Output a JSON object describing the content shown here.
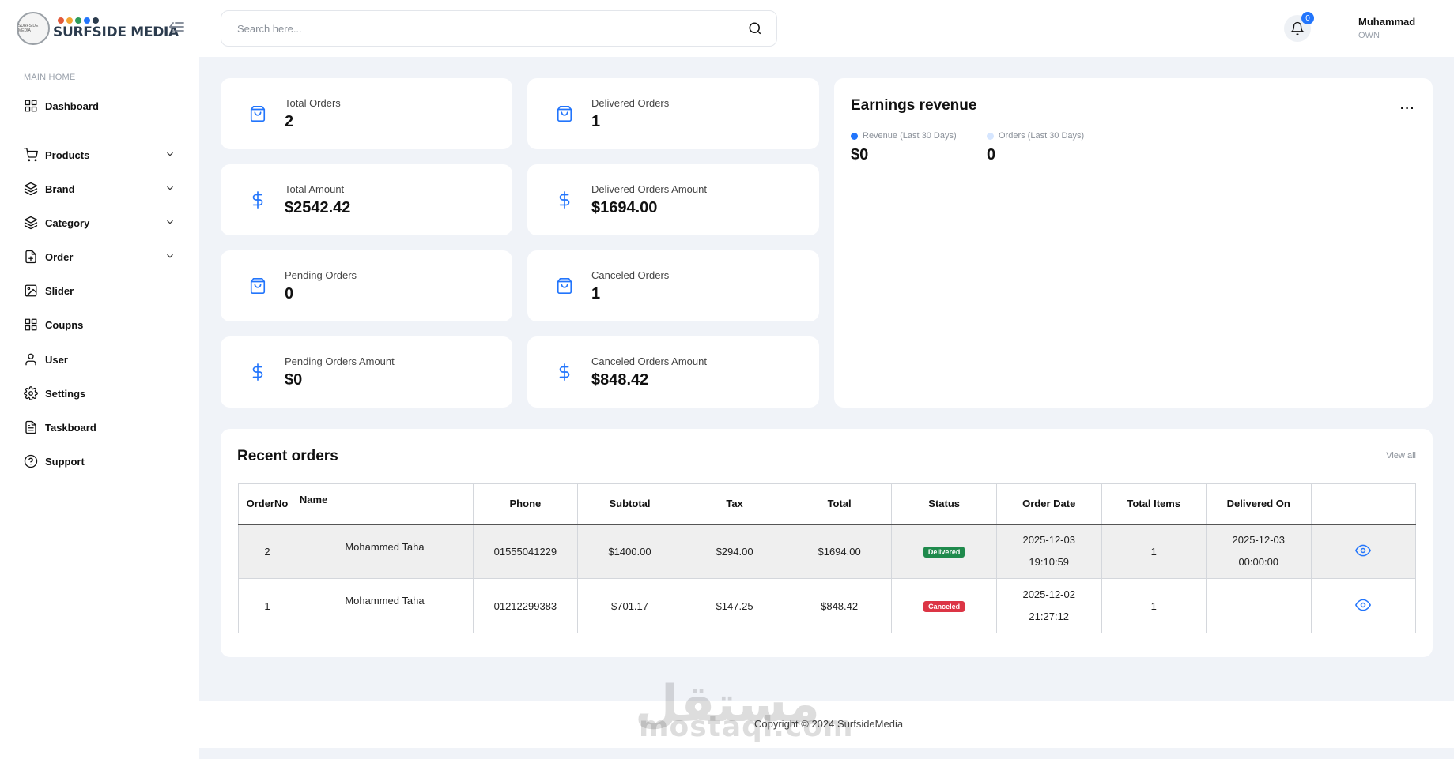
{
  "brand": {
    "name": "SURFSIDE MEDIA",
    "badge_text": "SURFSIDE MEDIA",
    "dot_colors": [
      "#e35b3b",
      "#f3a531",
      "#2e9c5a",
      "#2275fc",
      "#2b3b4d"
    ]
  },
  "sidebar": {
    "section_label": "MAIN HOME",
    "items": [
      {
        "label": "Dashboard",
        "icon": "grid-icon",
        "has_chevron": false
      },
      {
        "label": "Products",
        "icon": "cart-icon",
        "has_chevron": true
      },
      {
        "label": "Brand",
        "icon": "layers-icon",
        "has_chevron": true
      },
      {
        "label": "Category",
        "icon": "layers-icon",
        "has_chevron": true
      },
      {
        "label": "Order",
        "icon": "file-plus-icon",
        "has_chevron": true
      },
      {
        "label": "Slider",
        "icon": "image-icon",
        "has_chevron": false
      },
      {
        "label": "Coupns",
        "icon": "grid-icon",
        "has_chevron": false
      },
      {
        "label": "User",
        "icon": "user-icon",
        "has_chevron": false
      },
      {
        "label": "Settings",
        "icon": "gear-icon",
        "has_chevron": false
      },
      {
        "label": "Taskboard",
        "icon": "file-text-icon",
        "has_chevron": false
      },
      {
        "label": "Support",
        "icon": "help-circle-icon",
        "has_chevron": false
      }
    ]
  },
  "header": {
    "search_placeholder": "Search here...",
    "notification_count": "0",
    "user_name": "Muhammad",
    "user_role": "OWN"
  },
  "stats": [
    {
      "title": "Total Orders",
      "value": "2",
      "icon": "shopping-bag-icon"
    },
    {
      "title": "Delivered Orders",
      "value": "1",
      "icon": "shopping-bag-icon"
    },
    {
      "title": "Total Amount",
      "value": "$2542.42",
      "icon": "dollar-icon"
    },
    {
      "title": "Delivered Orders Amount",
      "value": "$1694.00",
      "icon": "dollar-icon"
    },
    {
      "title": "Pending Orders",
      "value": "0",
      "icon": "shopping-bag-icon"
    },
    {
      "title": "Canceled Orders",
      "value": "1",
      "icon": "shopping-bag-icon"
    },
    {
      "title": "Pending Orders Amount",
      "value": "$0",
      "icon": "dollar-icon"
    },
    {
      "title": "Canceled Orders Amount",
      "value": "$848.42",
      "icon": "dollar-icon"
    }
  ],
  "earnings": {
    "title": "Earnings revenue",
    "more": "···",
    "legend": [
      {
        "label": "Revenue (Last 30 Days)",
        "value": "$0",
        "color": "#2275fc"
      },
      {
        "label": "Orders (Last 30 Days)",
        "value": "0",
        "color": "#d6e6ff"
      }
    ]
  },
  "orders": {
    "title": "Recent orders",
    "view_all": "View all",
    "columns": [
      "OrderNo",
      "Name",
      "Phone",
      "Subtotal",
      "Tax",
      "Total",
      "Status",
      "Order Date",
      "Total Items",
      "Delivered On",
      ""
    ],
    "rows": [
      {
        "no": "2",
        "name": "Mohammed Taha",
        "phone": "01555041229",
        "subtotal": "$1400.00",
        "tax": "$294.00",
        "total": "$1694.00",
        "status": "Delivered",
        "status_color": "#1f8a4c",
        "date": "2025-12-03",
        "time": "19:10:59",
        "items": "1",
        "delivered_date": "2025-12-03",
        "delivered_time": "00:00:00"
      },
      {
        "no": "1",
        "name": "Mohammed Taha",
        "phone": "01212299383",
        "subtotal": "$701.17",
        "tax": "$147.25",
        "total": "$848.42",
        "status": "Canceled",
        "status_color": "#dc3545",
        "date": "2025-12-02",
        "time": "21:27:12",
        "items": "1",
        "delivered_date": "",
        "delivered_time": ""
      }
    ]
  },
  "footer": {
    "copyright": "Copyright © 2024 SurfsideMedia"
  },
  "watermark": {
    "arabic": "مستقل",
    "latin": "mostaql.com"
  }
}
